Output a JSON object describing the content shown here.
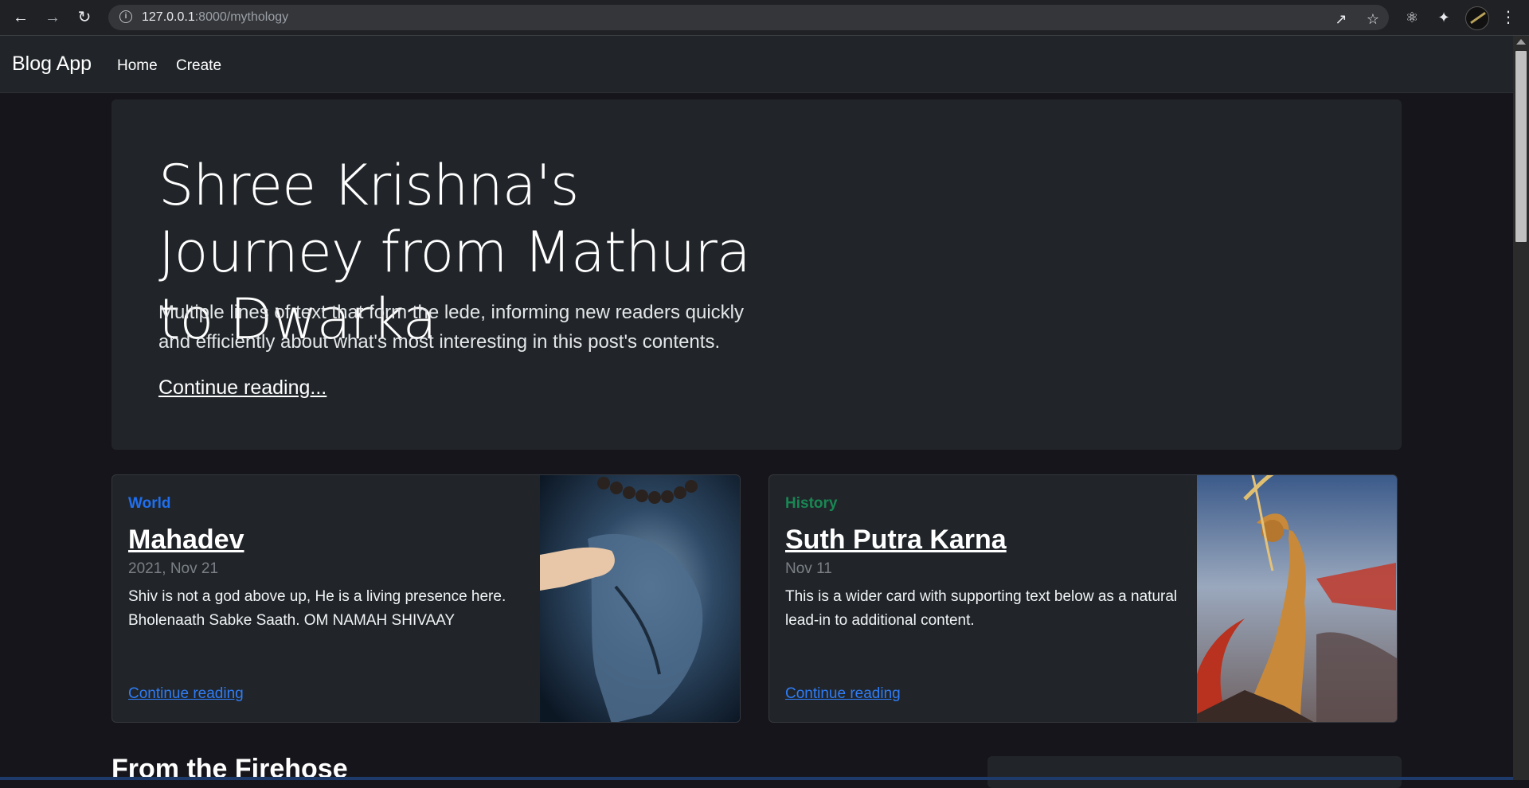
{
  "browser": {
    "url_host": "127.0.0.1",
    "url_path": ":8000/mythology"
  },
  "navbar": {
    "brand": "Blog App",
    "links": [
      "Home",
      "Create"
    ]
  },
  "hero": {
    "title": "Shree Krishna's Journey from Mathura to Dwarka",
    "lede": "Multiple lines of text that form the lede, informing new readers quickly and efficiently about what's most interesting in this post's contents.",
    "link": "Continue reading..."
  },
  "cards": [
    {
      "category": "World",
      "category_color": "#0d6efd",
      "title": "Mahadev",
      "date": "2021, Nov 21",
      "text": "Shiv is not a god above up, He is a living presence here. Bholenaath Sabke Saath. OM NAMAH SHIVAAY",
      "link": "Continue reading"
    },
    {
      "category": "History",
      "category_color": "#198754",
      "title": "Suth Putra Karna",
      "date": "Nov 11",
      "text": "This is a wider card with supporting text below as a natural lead-in to additional content.",
      "link": "Continue reading"
    }
  ],
  "section": {
    "heading": "From the Firehose"
  }
}
